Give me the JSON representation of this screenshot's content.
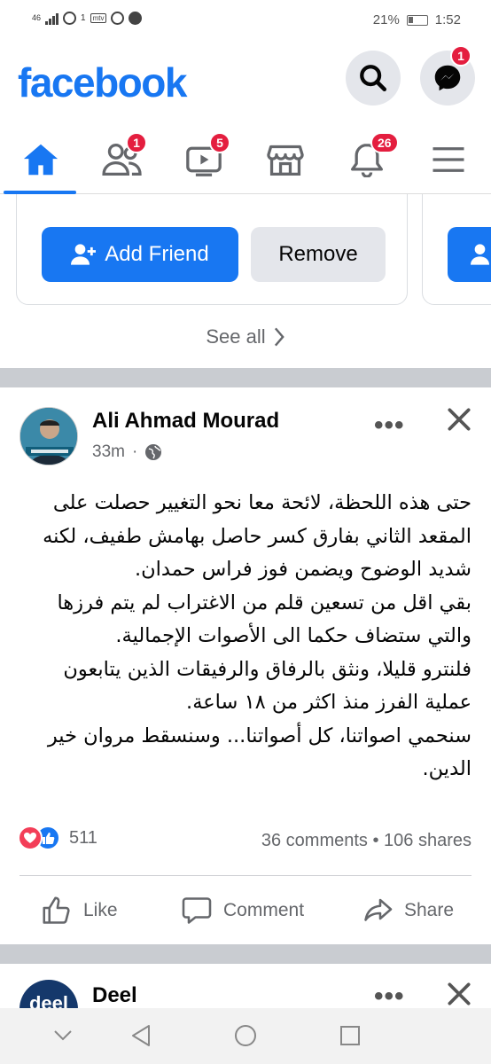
{
  "status_bar": {
    "network_label": "46",
    "sim_label": "1",
    "battery_percent": "21%",
    "time": "1:52"
  },
  "header": {
    "logo_text": "facebook",
    "messenger_badge": "1"
  },
  "nav": {
    "friends_badge": "1",
    "watch_badge": "5",
    "notifications_badge": "26",
    "active_tab": "home"
  },
  "suggestions": {
    "add_friend_label": "Add Friend",
    "remove_label": "Remove",
    "see_all_label": "See all"
  },
  "post": {
    "author": "Ali Ahmad Mourad",
    "time": "33m",
    "privacy_icon": "globe-icon",
    "text_lines": [
      "حتى هذه اللحظة، لائحة معا نحو التغيير حصلت على",
      "المقعد الثاني بفارق كسر حاصل بهامش طفيف، لكنه",
      "شديد الوضوح ويضمن فوز فراس حمدان.",
      "بقي اقل من تسعين قلم من الاغتراب لم يتم فرزها",
      "والتي ستضاف حكما الى الأصوات الإجمالية.",
      "فلنترو قليلا، ونثق بالرفاق والرفيقات الذين يتابعون",
      "عملية الفرز منذ اكثر من ١٨ ساعة.",
      "سنحمي اصواتنا، كل أصواتنا... وسنسقط مروان خير",
      "الدين."
    ],
    "reaction_count": "511",
    "comments_shares": "36 comments • 106 shares",
    "like_label": "Like",
    "comment_label": "Comment",
    "share_label": "Share"
  },
  "next_post": {
    "author": "Deel",
    "avatar_text": "deel"
  },
  "colors": {
    "brand": "#1877f2",
    "badge": "#e41e3f",
    "divider": "#c9ccd1"
  }
}
